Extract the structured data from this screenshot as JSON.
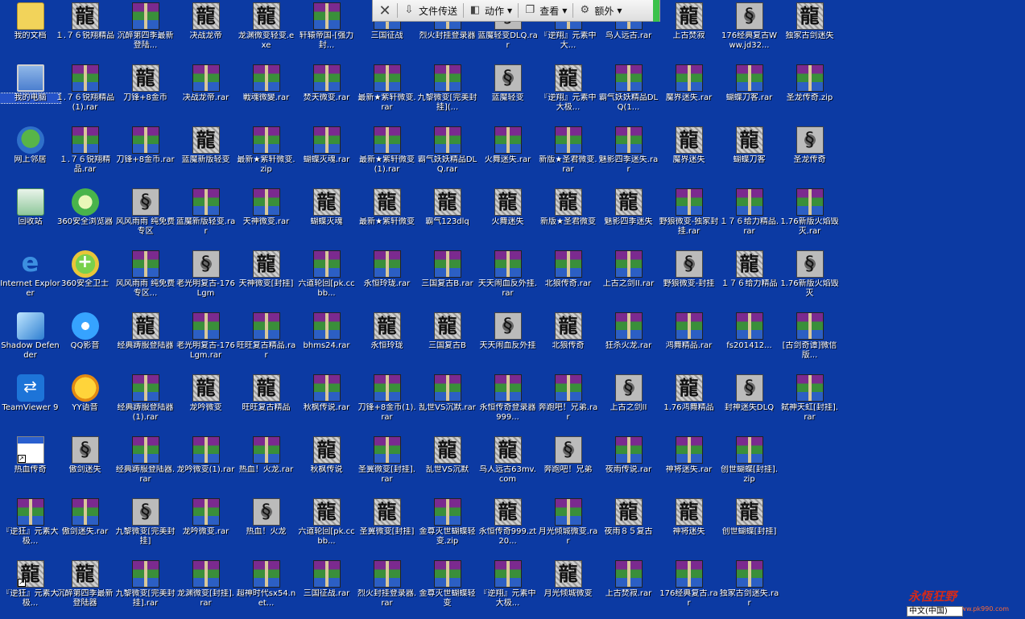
{
  "toolbar": {
    "file_transfer": "文件传送",
    "actions": "动作",
    "view": "查看",
    "extra": "额外"
  },
  "watermark": {
    "text": "永恆狂野",
    "url": "www.pk990.com"
  },
  "ime": {
    "label": "中文(中国)"
  },
  "columns": [
    [
      {
        "label": "我的文档",
        "icon": "folder-icon"
      },
      {
        "label": "我的电脑",
        "icon": "computer-icon",
        "selected": true
      },
      {
        "label": "网上邻居",
        "icon": "network-icon"
      },
      {
        "label": "回收站",
        "icon": "recycle-bin-icon"
      },
      {
        "label": "Internet Explorer",
        "icon": "ie-icon"
      },
      {
        "label": "Shadow Defender",
        "icon": "shadow-defender-icon"
      },
      {
        "label": "TeamViewer 9",
        "icon": "teamviewer-icon"
      },
      {
        "label": "热血传奇",
        "icon": "window-icon",
        "shortcut": true
      },
      {
        "label": "『逆狂』元素大极...",
        "icon": "rar-archive-icon"
      },
      {
        "label": "『逆狂』元素大极...",
        "icon": "dragon-logo-icon",
        "shortcut": true
      }
    ],
    [
      {
        "label": "１.７６锐翔精品",
        "icon": "dragon-logo-icon"
      },
      {
        "label": "１.７６锐翔精品(1).rar",
        "icon": "rar-archive-icon"
      },
      {
        "label": "１.７６锐翔精品.rar",
        "icon": "rar-archive-icon"
      },
      {
        "label": "360安全浏览器",
        "icon": "browser-360-icon"
      },
      {
        "label": "360安全卫士",
        "icon": "guard-360-icon"
      },
      {
        "label": "QQ影音",
        "icon": "qq-player-icon"
      },
      {
        "label": "YY语音",
        "icon": "yy-voice-icon"
      },
      {
        "label": "傲剑迷失",
        "icon": "dragon-emblem-icon"
      },
      {
        "label": "傲剑迷失.rar",
        "icon": "rar-archive-icon"
      },
      {
        "label": "沉醉第四季最新登陆器",
        "icon": "dragon-logo-icon"
      }
    ],
    [
      {
        "label": "沉醉第四季最新登陆...",
        "icon": "rar-archive-icon"
      },
      {
        "label": "刀锋+8金币",
        "icon": "dragon-logo-icon"
      },
      {
        "label": "刀锋+8金币.rar",
        "icon": "rar-archive-icon"
      },
      {
        "label": "风风雨雨 纯免费专区",
        "icon": "dragon-emblem-icon"
      },
      {
        "label": "风风雨雨 纯免费专区...",
        "icon": "rar-archive-icon"
      },
      {
        "label": "经典踌服登陆器",
        "icon": "dragon-logo-icon"
      },
      {
        "label": "经典踌服登陆器(1).rar",
        "icon": "rar-archive-icon"
      },
      {
        "label": "经典踌服登陆器.rar",
        "icon": "rar-archive-icon"
      },
      {
        "label": "九黎微变[完美封挂]",
        "icon": "dragon-emblem-icon"
      },
      {
        "label": "九黎微变[完美封挂].rar",
        "icon": "rar-archive-icon"
      }
    ],
    [
      {
        "label": "决战龙帝",
        "icon": "dragon-logo-icon"
      },
      {
        "label": "决战龙帝.rar",
        "icon": "rar-archive-icon"
      },
      {
        "label": "蓝魔新版轻变",
        "icon": "dragon-logo-icon"
      },
      {
        "label": "蓝魔新版轻变.rar",
        "icon": "rar-archive-icon"
      },
      {
        "label": "老光明复古-176Lgm",
        "icon": "dragon-emblem-icon"
      },
      {
        "label": "老光明复古-176Lgm.rar",
        "icon": "rar-archive-icon"
      },
      {
        "label": "龙吟微变",
        "icon": "dragon-logo-icon"
      },
      {
        "label": "龙吟微变(1).rar",
        "icon": "rar-archive-icon"
      },
      {
        "label": "龙吟微变.rar",
        "icon": "rar-archive-icon"
      },
      {
        "label": "龙渊微变[封挂].rar",
        "icon": "rar-archive-icon"
      }
    ],
    [
      {
        "label": "龙渊微变轻变.exe",
        "icon": "dragon-logo-icon"
      },
      {
        "label": "戰魂微變.rar",
        "icon": "rar-archive-icon"
      },
      {
        "label": "最新★紫轩微变.zip",
        "icon": "rar-archive-icon"
      },
      {
        "label": "天神微变.rar",
        "icon": "rar-archive-icon"
      },
      {
        "label": "天神微变[封挂]",
        "icon": "dragon-logo-icon"
      },
      {
        "label": "旺旺复古精品.rar",
        "icon": "rar-archive-icon"
      },
      {
        "label": "旺旺复古精品",
        "icon": "dragon-logo-icon"
      },
      {
        "label": "热血！火龙.rar",
        "icon": "rar-archive-icon"
      },
      {
        "label": "热血！火龙",
        "icon": "dragon-emblem-icon"
      },
      {
        "label": "超神时代sx54.net...",
        "icon": "rar-archive-icon"
      }
    ],
    [
      {
        "label": "轩辕帝国-[强力封...",
        "icon": "rar-archive-icon"
      },
      {
        "label": "焚天微变.rar",
        "icon": "rar-archive-icon"
      },
      {
        "label": "蝴蝶灭魂.rar",
        "icon": "rar-archive-icon"
      },
      {
        "label": "蝴蝶灭魂",
        "icon": "dragon-logo-icon"
      },
      {
        "label": "六道轮回[pk.ccbb...",
        "icon": "rar-archive-icon"
      },
      {
        "label": "bhms24.rar",
        "icon": "rar-archive-icon"
      },
      {
        "label": "秋枫传说.rar",
        "icon": "rar-archive-icon"
      },
      {
        "label": "秋枫传说",
        "icon": "dragon-logo-icon"
      },
      {
        "label": "六道轮回[pk.ccbb...",
        "icon": "dragon-logo-icon"
      },
      {
        "label": "三国征战.rar",
        "icon": "rar-archive-icon"
      }
    ],
    [
      {
        "label": "三国征战",
        "icon": "rar-archive-icon"
      },
      {
        "label": "最新★紫轩微变.rar",
        "icon": "rar-archive-icon"
      },
      {
        "label": "最新★紫轩微变(1).rar",
        "icon": "rar-archive-icon"
      },
      {
        "label": "最新★紫轩微变",
        "icon": "dragon-logo-icon"
      },
      {
        "label": "永恒玲珑.rar",
        "icon": "rar-archive-icon"
      },
      {
        "label": "永恒玲珑",
        "icon": "dragon-logo-icon"
      },
      {
        "label": "刀锋+8金币(1).rar",
        "icon": "rar-archive-icon"
      },
      {
        "label": "圣翼微变[封挂].rar",
        "icon": "rar-archive-icon"
      },
      {
        "label": "圣翼微变[封挂]",
        "icon": "dragon-logo-icon"
      },
      {
        "label": "烈火封挂登录器.rar",
        "icon": "rar-archive-icon"
      }
    ],
    [
      {
        "label": "烈火封挂登录器",
        "icon": "rar-archive-icon"
      },
      {
        "label": "九黎微变[完美封挂](...",
        "icon": "rar-archive-icon"
      },
      {
        "label": "霸气妖妖精品DLQ.rar",
        "icon": "rar-archive-icon"
      },
      {
        "label": "霸气123dlq",
        "icon": "dragon-logo-icon"
      },
      {
        "label": "三国复古B.rar",
        "icon": "rar-archive-icon"
      },
      {
        "label": "三国复古B",
        "icon": "dragon-logo-icon"
      },
      {
        "label": "乱世VS沉默.rar",
        "icon": "rar-archive-icon"
      },
      {
        "label": "乱世VS沉默",
        "icon": "dragon-logo-icon"
      },
      {
        "label": "金尊灭世蝴蝶轻变.zip",
        "icon": "rar-archive-icon"
      },
      {
        "label": "金尊灭世蝴蝶轻变",
        "icon": "rar-archive-icon"
      }
    ],
    [
      {
        "label": "蓝魔轻变DLQ.rar",
        "icon": "dragon-emblem-icon"
      },
      {
        "label": "蓝魔轻变",
        "icon": "dragon-emblem-icon"
      },
      {
        "label": "火舞迷失.rar",
        "icon": "rar-archive-icon"
      },
      {
        "label": "火舞迷失",
        "icon": "dragon-logo-icon"
      },
      {
        "label": "天天闹血反外挂.rar",
        "icon": "rar-archive-icon"
      },
      {
        "label": "天天闹血反外挂",
        "icon": "dragon-emblem-icon"
      },
      {
        "label": "永恒传奇登录器999...",
        "icon": "rar-archive-icon"
      },
      {
        "label": "鸟人远古63mv.com",
        "icon": "dragon-logo-icon"
      },
      {
        "label": "永恒传奇999.zt20...",
        "icon": "dragon-logo-icon"
      },
      {
        "label": "『逆翔』元素中大极...",
        "icon": "rar-archive-icon"
      }
    ],
    [
      {
        "label": "『逆翔』元素中大...",
        "icon": "rar-archive-icon"
      },
      {
        "label": "『逆翔』元素中大极...",
        "icon": "dragon-logo-icon"
      },
      {
        "label": "新版★圣君微变.rar",
        "icon": "rar-archive-icon"
      },
      {
        "label": "新版★圣君微变",
        "icon": "dragon-logo-icon"
      },
      {
        "label": "北狼传奇.rar",
        "icon": "rar-archive-icon"
      },
      {
        "label": "北狼传奇",
        "icon": "dragon-logo-icon"
      },
      {
        "label": "奔跑吧！兄弟.rar",
        "icon": "rar-archive-icon"
      },
      {
        "label": "奔跑吧！兄弟",
        "icon": "dragon-emblem-icon"
      },
      {
        "label": "月光倾城微变.rar",
        "icon": "rar-archive-icon"
      },
      {
        "label": "月光倾城微变",
        "icon": "dragon-logo-icon"
      }
    ],
    [
      {
        "label": "鸟人远古.rar",
        "icon": "rar-archive-icon"
      },
      {
        "label": "霸气妖妖精品DLQ(1...",
        "icon": "rar-archive-icon"
      },
      {
        "label": "魅影四季迷失.rar",
        "icon": "rar-archive-icon"
      },
      {
        "label": "魅影四季迷失",
        "icon": "dragon-logo-icon"
      },
      {
        "label": "上古之剑II.rar",
        "icon": "rar-archive-icon"
      },
      {
        "label": "狂杀火龙.rar",
        "icon": "rar-archive-icon"
      },
      {
        "label": "上古之剑II",
        "icon": "dragon-emblem-icon"
      },
      {
        "label": "夜雨传说.rar",
        "icon": "rar-archive-icon"
      },
      {
        "label": "夜雨８５复古",
        "icon": "dragon-logo-icon"
      },
      {
        "label": "上古焚寂.rar",
        "icon": "rar-archive-icon"
      }
    ],
    [
      {
        "label": "上古焚寂",
        "icon": "dragon-logo-icon"
      },
      {
        "label": "魔界迷失.rar",
        "icon": "rar-archive-icon"
      },
      {
        "label": "魔界迷失",
        "icon": "dragon-logo-icon"
      },
      {
        "label": "野狼微变-独家封挂.rar",
        "icon": "rar-archive-icon"
      },
      {
        "label": "野狼微变-封挂",
        "icon": "dragon-emblem-icon"
      },
      {
        "label": "鸿舞精品.rar",
        "icon": "rar-archive-icon"
      },
      {
        "label": "1.76鸿舞精品",
        "icon": "dragon-logo-icon"
      },
      {
        "label": "神将迷失.rar",
        "icon": "rar-archive-icon"
      },
      {
        "label": "神将迷失",
        "icon": "dragon-logo-icon"
      },
      {
        "label": "176经典复古.rar",
        "icon": "rar-archive-icon"
      }
    ],
    [
      {
        "label": "176经典复古Www.jd32...",
        "icon": "dragon-emblem-icon"
      },
      {
        "label": "蝴蝶刀客.rar",
        "icon": "rar-archive-icon"
      },
      {
        "label": "蝴蝶刀客",
        "icon": "dragon-logo-icon"
      },
      {
        "label": "１７６给力精品.rar",
        "icon": "rar-archive-icon"
      },
      {
        "label": "１７６给力精品",
        "icon": "dragon-logo-icon"
      },
      {
        "label": "fs201412...",
        "icon": "rar-archive-icon"
      },
      {
        "label": "封神迷失DLQ",
        "icon": "dragon-emblem-icon"
      },
      {
        "label": "创世蝴蝶[封挂].zip",
        "icon": "rar-archive-icon"
      },
      {
        "label": "创世蝴蝶[封挂]",
        "icon": "dragon-logo-icon"
      },
      {
        "label": "独家古剑迷失.rar",
        "icon": "rar-archive-icon"
      }
    ],
    [
      {
        "label": "独家古剑迷失",
        "icon": "dragon-logo-icon"
      },
      {
        "label": "圣龙传奇.zip",
        "icon": "rar-archive-icon"
      },
      {
        "label": "圣龙传奇",
        "icon": "dragon-emblem-icon"
      },
      {
        "label": "1.76新版火焰毁灭.rar",
        "icon": "rar-archive-icon"
      },
      {
        "label": "1.76新版火焰毁灭",
        "icon": "dragon-emblem-icon"
      },
      {
        "label": "[古剑奇谭]微信版...",
        "icon": "rar-archive-icon"
      },
      {
        "label": "弑神天虹[封挂].rar",
        "icon": "rar-archive-icon"
      }
    ]
  ]
}
